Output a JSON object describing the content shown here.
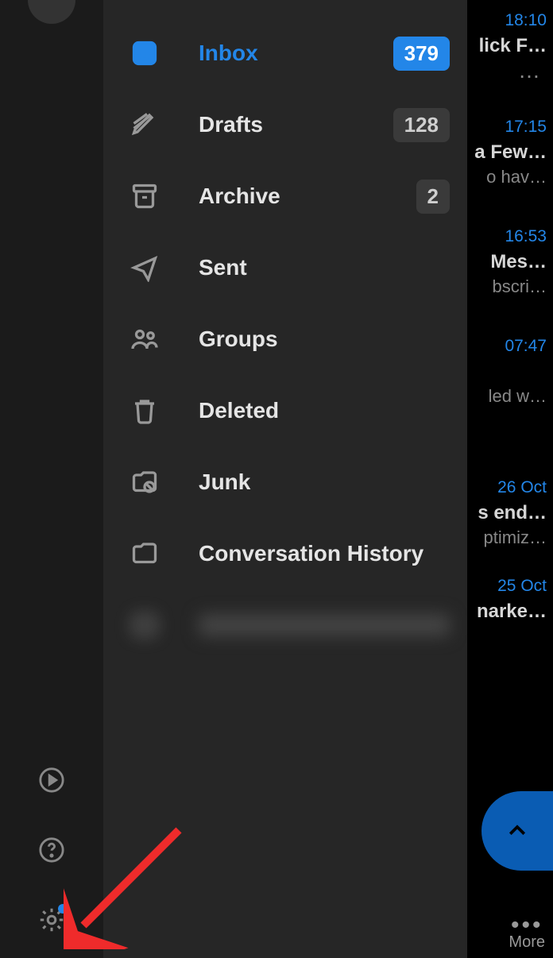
{
  "sidebar": {
    "folders": [
      {
        "label": "Inbox",
        "count": "379",
        "active": true,
        "icon": "inbox-icon"
      },
      {
        "label": "Drafts",
        "count": "128",
        "active": false,
        "icon": "drafts-icon"
      },
      {
        "label": "Archive",
        "count": "2",
        "active": false,
        "icon": "archive-icon"
      },
      {
        "label": "Sent",
        "count": "",
        "active": false,
        "icon": "sent-icon"
      },
      {
        "label": "Groups",
        "count": "",
        "active": false,
        "icon": "groups-icon"
      },
      {
        "label": "Deleted",
        "count": "",
        "active": false,
        "icon": "deleted-icon"
      },
      {
        "label": "Junk",
        "count": "",
        "active": false,
        "icon": "junk-icon"
      },
      {
        "label": "Conversation History",
        "count": "",
        "active": false,
        "icon": "conversation-history-icon"
      }
    ]
  },
  "rail": {
    "play_icon": "play-icon",
    "help_icon": "help-icon",
    "settings_icon": "settings-icon",
    "settings_has_dot": true
  },
  "emails": [
    {
      "time": "18:10",
      "subject": "lick F…",
      "preview": "",
      "dots": "…"
    },
    {
      "time": "17:15",
      "subject": "a Few…",
      "preview": "o hav…"
    },
    {
      "time": "16:53",
      "subject": " Mes…",
      "preview": "bscri…"
    },
    {
      "time": "07:47",
      "subject": "",
      "preview": "led w…"
    },
    {
      "time": "26 Oct",
      "subject": "s end…",
      "preview": "ptimiz…"
    },
    {
      "time": "25 Oct",
      "subject": "narke…",
      "preview": ""
    }
  ],
  "more_label": "More"
}
